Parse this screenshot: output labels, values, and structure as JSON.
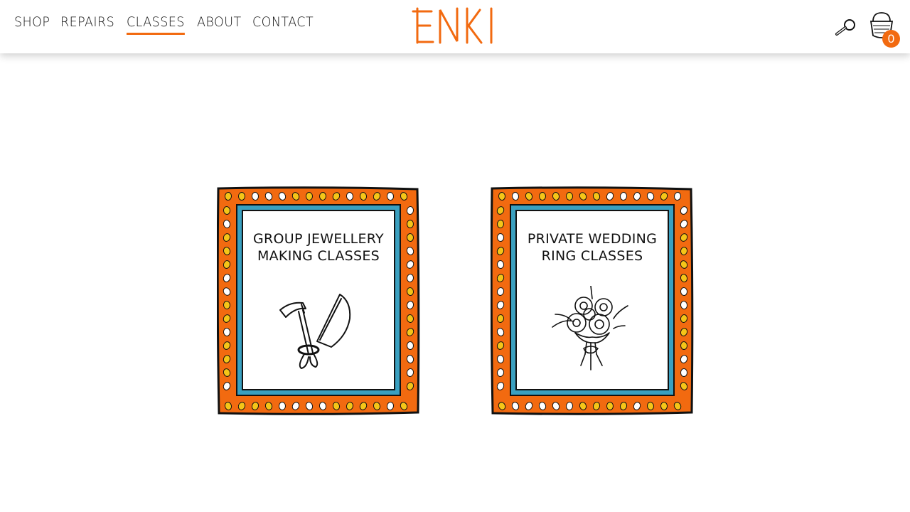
{
  "brand": {
    "logo_text": "ENKI",
    "accent": "#f26a10"
  },
  "nav": {
    "items": [
      {
        "label": "SHOP",
        "active": false
      },
      {
        "label": "REPAIRS",
        "active": false
      },
      {
        "label": "CLASSES",
        "active": true
      },
      {
        "label": "ABOUT",
        "active": false
      },
      {
        "label": "CONTACT",
        "active": false
      }
    ]
  },
  "cart": {
    "count": "0"
  },
  "icons": {
    "search": "magnifier-icon",
    "cart": "basket-icon"
  },
  "cards": [
    {
      "title": "GROUP JEWELLERY MAKING CLASSES",
      "icon": "hammer-and-saw-icon"
    },
    {
      "title": "PRIVATE WEDDING RING CLASSES",
      "icon": "flower-bouquet-icon"
    }
  ],
  "colors": {
    "frame_orange": "#f26a10",
    "frame_blue": "#3aa0c0",
    "dot_yellow": "#f5c518",
    "dot_white": "#ffffff"
  }
}
